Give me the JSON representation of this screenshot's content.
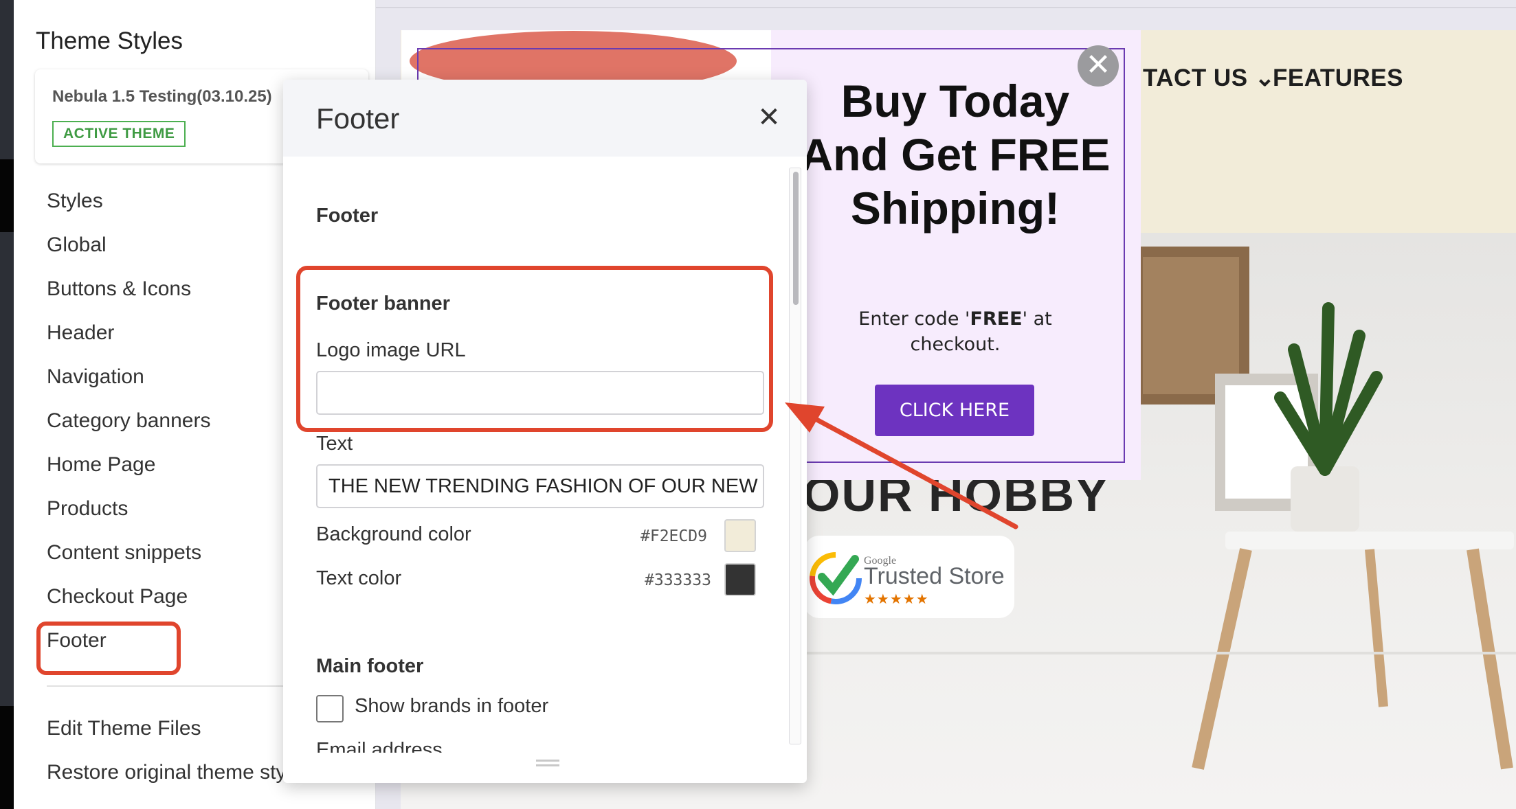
{
  "sidebar": {
    "title": "Theme Styles",
    "theme_card": {
      "name": "Nebula 1.5 Testing(03.10.25)",
      "badge": "ACTIVE THEME"
    },
    "items": [
      {
        "label": "Styles"
      },
      {
        "label": "Global"
      },
      {
        "label": "Buttons & Icons"
      },
      {
        "label": "Header"
      },
      {
        "label": "Navigation"
      },
      {
        "label": "Category banners"
      },
      {
        "label": "Home Page"
      },
      {
        "label": "Products"
      },
      {
        "label": "Content snippets"
      },
      {
        "label": "Checkout Page"
      },
      {
        "label": "Footer"
      }
    ],
    "bottom_items": [
      {
        "label": "Edit Theme Files"
      },
      {
        "label": "Restore original theme styles"
      }
    ]
  },
  "preview": {
    "nav": {
      "contact_label": "TACT US",
      "features_label": "FEATURES"
    },
    "hero_heading": "OUR HOBBY",
    "trusted_badge": {
      "brand": "Google",
      "text": "Trusted Store",
      "stars": "★★★★★"
    },
    "popup": {
      "headline": "Buy Today And Get FREE Shipping!",
      "sub_prefix": "Enter code '",
      "sub_code": "FREE",
      "sub_suffix": "' at checkout.",
      "cta": "CLICK HERE",
      "close_glyph": "✕"
    }
  },
  "panel": {
    "title": "Footer",
    "close_glyph": "✕",
    "section_footer": "Footer",
    "section_banner": "Footer banner",
    "logo_label": "Logo image URL",
    "logo_value": "",
    "text_label": "Text",
    "text_value": "THE NEW TRENDING FASHION OF OUR NEW G",
    "bg_color_label": "Background color",
    "bg_color_value": "#F2ECD9",
    "text_color_label": "Text color",
    "text_color_value": "#333333",
    "section_main": "Main footer",
    "show_brands_label": "Show brands in footer",
    "email_label": "Email address"
  },
  "colors": {
    "accent_annotation": "#e0452d",
    "popup_purple": "#6d33c0",
    "active_badge": "#4caf50",
    "header_bg": "#F2ECD9",
    "text_color": "#333333"
  }
}
